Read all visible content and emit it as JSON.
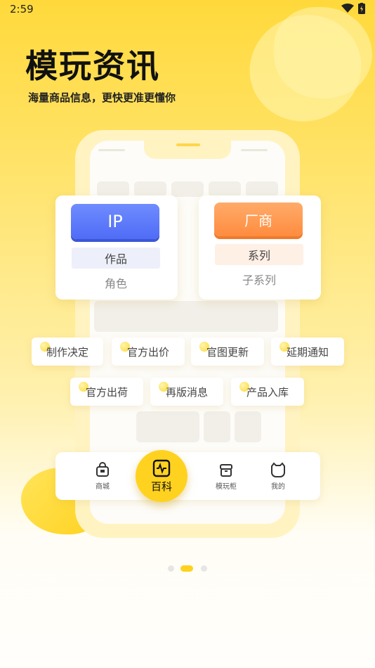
{
  "status": {
    "time": "2:59"
  },
  "hero": {
    "title": "模玩资讯",
    "subtitle": "海量商品信息，更快更准更懂你"
  },
  "cards": {
    "ip": {
      "button": "IP",
      "pill": "作品",
      "plain": "角色",
      "color": "#5a77fb"
    },
    "factory": {
      "button": "厂商",
      "pill": "系列",
      "plain": "子系列",
      "color": "#ff9447"
    }
  },
  "tags": [
    "制作决定",
    "官方出价",
    "官图更新",
    "延期通知",
    "官方出荷",
    "再版消息",
    "产品入库"
  ],
  "nav": {
    "items": [
      {
        "label": "商城",
        "icon": "shopping-bag-icon"
      },
      {
        "label": "百科",
        "icon": "encyclopedia-icon"
      },
      {
        "label": "模玩柜",
        "icon": "cabinet-icon"
      },
      {
        "label": "我的",
        "icon": "profile-icon"
      }
    ],
    "accent": "#ffd21f"
  },
  "pager": {
    "count": 3,
    "active": 2
  }
}
